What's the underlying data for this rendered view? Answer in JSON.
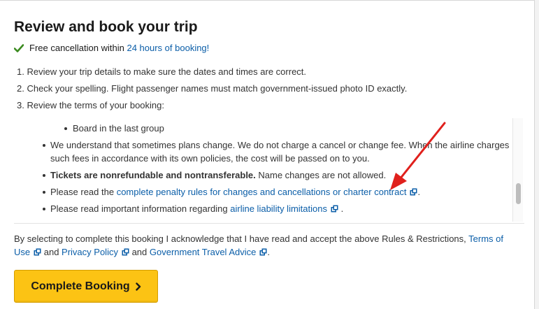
{
  "header": {
    "title": "Review and book your trip"
  },
  "free_cancellation": {
    "prefix": "Free cancellation within ",
    "link": "24 hours of booking!"
  },
  "steps": [
    "1. Review your trip details to make sure the dates and times are correct.",
    "2. Check your spelling. Flight passenger names must match government-issued photo ID exactly.",
    "3. Review the terms of your booking:"
  ],
  "terms": {
    "sub_bullet": "Board in the last group",
    "change_policy": "We understand that sometimes plans change. We do not charge a cancel or change fee. When the airline charges such fees in accordance with its own policies, the cost will be passed on to you.",
    "nonrefundable_bold": "Tickets are nonrefundable and nontransferable.",
    "nonrefundable_rest": " Name changes are not allowed.",
    "penalty_prefix": "Please read the ",
    "penalty_link": "complete penalty rules for changes and cancellations or charter contract",
    "penalty_suffix": ".",
    "liability_prefix": "Please read important information regarding ",
    "liability_link": "airline liability limitations",
    "liability_suffix": " ."
  },
  "acknowledgement": {
    "text": "By selecting to complete this booking I acknowledge that I have read and accept the above Rules & Restrictions, ",
    "terms_link": "Terms of Use",
    "and1": " and ",
    "privacy_link": "Privacy Policy",
    "and2": " and ",
    "travel_link": "Government Travel Advice",
    "end": "."
  },
  "booking_button": {
    "label": "Complete Booking"
  },
  "colors": {
    "link": "#0b5ea8",
    "button": "#fcc314",
    "check": "#3a8a1f",
    "annotation_arrow": "#e0201c"
  },
  "icons": [
    "check-icon",
    "external-link-icon",
    "chevron-right-icon"
  ]
}
